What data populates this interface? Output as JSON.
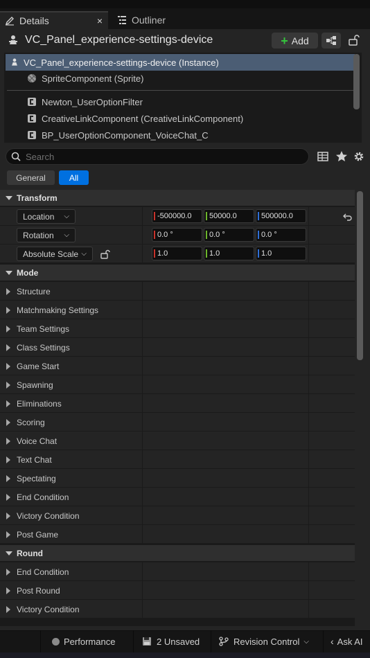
{
  "tabs": [
    {
      "label": "Details",
      "icon": "pencil-icon",
      "active": true,
      "close": "×"
    },
    {
      "label": "Outliner",
      "icon": "list-icon",
      "active": false
    }
  ],
  "header": {
    "title": "VC_Panel_experience-settings-device",
    "add_label": "Add"
  },
  "tree": {
    "items": [
      {
        "label": "VC_Panel_experience-settings-device (Instance)",
        "icon": "actor-icon",
        "selected": true
      },
      {
        "label": "SpriteComponent (Sprite)",
        "icon": "sprite-icon"
      },
      {
        "label": "Newton_UserOptionFilter",
        "icon": "component-icon"
      },
      {
        "label": "CreativeLinkComponent (CreativeLinkComponent)",
        "icon": "component-icon"
      },
      {
        "label": "BP_UserOptionComponent_VoiceChat_C",
        "icon": "component-icon"
      }
    ]
  },
  "search": {
    "placeholder": "Search"
  },
  "filters": {
    "general": "General",
    "all": "All"
  },
  "transform": {
    "category": "Transform",
    "location": {
      "label": "Location",
      "x": "-500000.0",
      "y": "50000.0",
      "z": "500000.0"
    },
    "rotation": {
      "label": "Rotation",
      "x": "0.0 °",
      "y": "0.0 °",
      "z": "0.0 °"
    },
    "scale": {
      "label": "Absolute Scale",
      "x": "1.0",
      "y": "1.0",
      "z": "1.0"
    }
  },
  "mode": {
    "category": "Mode",
    "items": [
      "Structure",
      "Matchmaking Settings",
      "Team Settings",
      "Class Settings",
      "Game Start",
      "Spawning",
      "Eliminations",
      "Scoring",
      "Voice Chat",
      "Text Chat",
      "Spectating",
      "End Condition",
      "Victory Condition",
      "Post Game"
    ]
  },
  "round": {
    "category": "Round",
    "items": [
      "End Condition",
      "Post Round",
      "Victory Condition"
    ]
  },
  "status": {
    "performance": "Performance",
    "unsaved": "2 Unsaved",
    "revision": "Revision Control",
    "ask": "Ask AI"
  },
  "colors": {
    "x_axis": "#c8332b",
    "y_axis": "#6cb52b",
    "z_axis": "#2f6fd6",
    "accent": "#0070e0",
    "add_plus": "#35c43d"
  }
}
